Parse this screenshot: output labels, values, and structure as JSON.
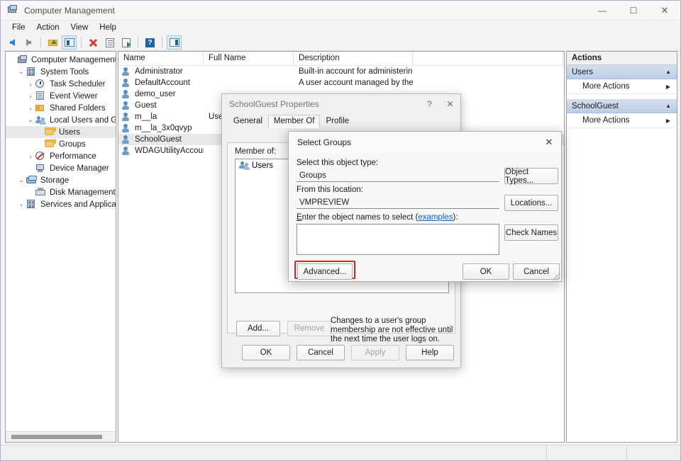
{
  "window": {
    "title": "Computer Management",
    "icon": "computer-management-icon",
    "minimize": "—",
    "maximize": "☐",
    "close": "✕"
  },
  "menu": {
    "items": [
      "File",
      "Action",
      "View",
      "Help"
    ]
  },
  "toolbar": {
    "buttons": [
      {
        "name": "back-icon",
        "kind": "arrow-left"
      },
      {
        "name": "forward-icon",
        "kind": "arrow-right"
      },
      {
        "name": "up-one-level-icon",
        "kind": "up"
      },
      {
        "name": "show-hide-console-tree-icon",
        "kind": "grid",
        "framed": true
      },
      {
        "name": "delete-icon",
        "kind": "x"
      },
      {
        "name": "properties-icon",
        "kind": "doc"
      },
      {
        "name": "export-list-icon",
        "kind": "export"
      },
      {
        "name": "help-icon",
        "kind": "help"
      },
      {
        "name": "show-hide-action-pane-icon",
        "kind": "pane",
        "framed": true
      }
    ]
  },
  "tree": {
    "nodes": [
      {
        "label": "Computer Management (Local",
        "depth": 0,
        "twist": "",
        "icon": "mmc-icon",
        "selected": false
      },
      {
        "label": "System Tools",
        "depth": 1,
        "twist": "⌄",
        "icon": "system-tools-icon",
        "selected": false
      },
      {
        "label": "Task Scheduler",
        "depth": 2,
        "twist": "›",
        "icon": "task-scheduler-icon",
        "selected": false
      },
      {
        "label": "Event Viewer",
        "depth": 2,
        "twist": "›",
        "icon": "event-viewer-icon",
        "selected": false
      },
      {
        "label": "Shared Folders",
        "depth": 2,
        "twist": "›",
        "icon": "shared-folders-icon",
        "selected": false
      },
      {
        "label": "Local Users and Groups",
        "depth": 2,
        "twist": "⌄",
        "icon": "local-users-groups-icon",
        "selected": false
      },
      {
        "label": "Users",
        "depth": 3,
        "twist": "",
        "icon": "folder-icon",
        "selected": true
      },
      {
        "label": "Groups",
        "depth": 3,
        "twist": "",
        "icon": "folder-icon",
        "selected": false
      },
      {
        "label": "Performance",
        "depth": 2,
        "twist": "›",
        "icon": "performance-icon",
        "selected": false
      },
      {
        "label": "Device Manager",
        "depth": 2,
        "twist": "",
        "icon": "device-manager-icon",
        "selected": false
      },
      {
        "label": "Storage",
        "depth": 1,
        "twist": "⌄",
        "icon": "storage-icon",
        "selected": false
      },
      {
        "label": "Disk Management",
        "depth": 2,
        "twist": "",
        "icon": "disk-management-icon",
        "selected": false
      },
      {
        "label": "Services and Applications",
        "depth": 1,
        "twist": "›",
        "icon": "services-applications-icon",
        "selected": false
      }
    ]
  },
  "list": {
    "columns": [
      "Name",
      "Full Name",
      "Description",
      ""
    ],
    "rows": [
      {
        "name": "Administrator",
        "full": "",
        "desc": "Built-in account for administering...",
        "selected": false
      },
      {
        "name": "DefaultAccount",
        "full": "",
        "desc": "A user account managed by the s...",
        "selected": false
      },
      {
        "name": "demo_user",
        "full": "",
        "desc": "",
        "selected": false
      },
      {
        "name": "Guest",
        "full": "",
        "desc": "",
        "selected": false
      },
      {
        "name": "m__la",
        "full": "User",
        "desc": "",
        "selected": false
      },
      {
        "name": "m__la_3x0qvyp",
        "full": "",
        "desc": "",
        "selected": false
      },
      {
        "name": "SchoolGuest",
        "full": "",
        "desc": "",
        "selected": true
      },
      {
        "name": "WDAGUtilityAccount",
        "full": "",
        "desc": "",
        "selected": false
      }
    ]
  },
  "actions": {
    "title": "Actions",
    "groups": [
      {
        "header": "Users",
        "items": [
          "More Actions"
        ]
      },
      {
        "header": "SchoolGuest",
        "items": [
          "More Actions"
        ]
      }
    ],
    "collapse_caret": "▲",
    "submenu_arrow": "▶"
  },
  "properties_dialog": {
    "title": "SchoolGuest Properties",
    "help_btn": "?",
    "close_btn": "✕",
    "tabs": [
      {
        "label": "General",
        "active": false
      },
      {
        "label": "Member Of",
        "active": true
      },
      {
        "label": "Profile",
        "active": false
      }
    ],
    "member_of_label": "Member of:",
    "members": [
      {
        "name": "Users",
        "icon": "group-icon"
      }
    ],
    "add_button": "Add...",
    "remove_button": "Remove",
    "note": "Changes to a user's group membership are not effective until the next time the user logs on.",
    "footer_buttons": [
      {
        "label": "OK",
        "disabled": false
      },
      {
        "label": "Cancel",
        "disabled": false
      },
      {
        "label": "Apply",
        "disabled": true
      },
      {
        "label": "Help",
        "disabled": false
      }
    ]
  },
  "select_groups_dialog": {
    "title": "Select Groups",
    "close_btn": "✕",
    "object_type_label": "Select this object type:",
    "object_type_value": "Groups",
    "object_types_button": "Object Types...",
    "location_label": "From this location:",
    "location_value": "VMPREVIEW",
    "locations_button": "Locations...",
    "names_label_before": "E",
    "names_label_rest": "nter the object names to select (",
    "names_label_link": "examples",
    "names_label_after": "):",
    "names_value": "",
    "check_names_button": "Check Names",
    "advanced_button": "Advanced...",
    "ok_button": "OK",
    "cancel_button": "Cancel",
    "highlight_color": "#e02020"
  }
}
